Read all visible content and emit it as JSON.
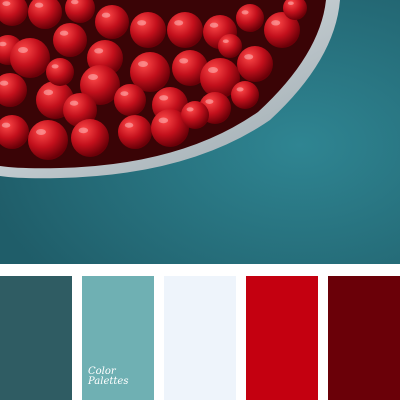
{
  "photo": {
    "subject": "bowl-of-wild-strawberries",
    "background_color": "#2b7380",
    "bowl_color": "#c9d0d4",
    "berry_color": "#c0101c"
  },
  "palette": {
    "colors": [
      "#2f5c63",
      "#6fb0b3",
      "#eef4fb",
      "#c40010",
      "#6a0008"
    ]
  },
  "logo": {
    "line1": "Color",
    "line2": "Palettes"
  }
}
